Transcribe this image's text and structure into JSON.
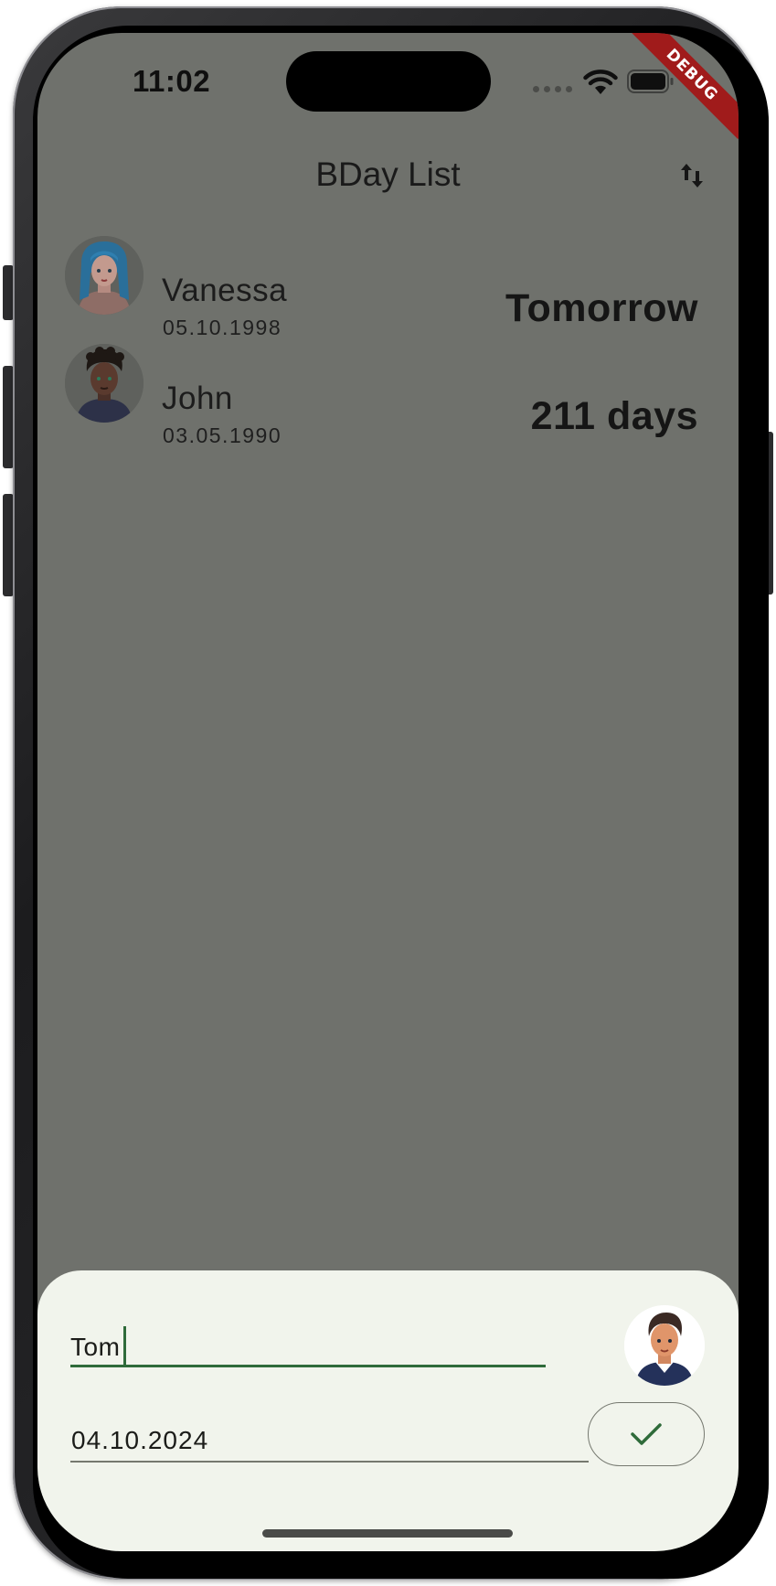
{
  "status_bar": {
    "time": "11:02"
  },
  "debug_banner": "DEBUG",
  "app_bar": {
    "title": "BDay List",
    "sort_icon": "swap-vert-icon"
  },
  "people": [
    {
      "name": "Vanessa",
      "date": "05.10.1998",
      "countdown": "Tomorrow",
      "avatar": "avatar-blue-hair-woman"
    },
    {
      "name": "John",
      "date": "03.05.1990",
      "countdown": "211 days",
      "avatar": "avatar-curly-hair-man"
    }
  ],
  "sheet": {
    "name_value": "Tom",
    "date_value": "04.10.2024",
    "avatar": "avatar-brown-hair-man",
    "confirm_icon": "check-icon"
  },
  "colors": {
    "scrim_background": "#6f716c",
    "sheet_background": "#f1f4ec",
    "accent": "#2f6b3a",
    "debug_banner": "#a01b1b"
  }
}
